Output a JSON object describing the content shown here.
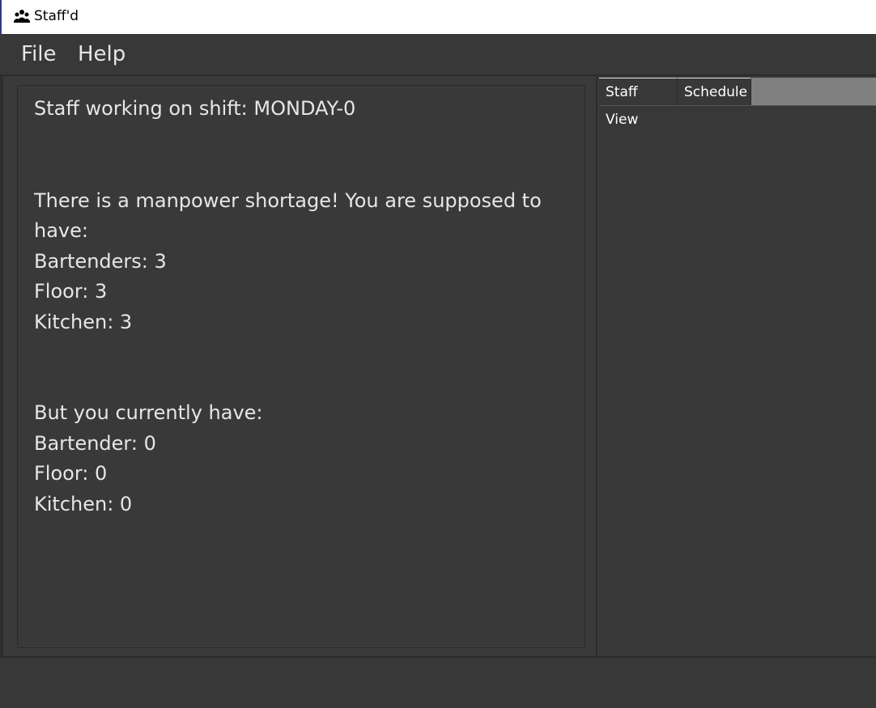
{
  "window": {
    "title": "Staff'd",
    "icon": "people-icon"
  },
  "menu": {
    "items": [
      {
        "label": "File"
      },
      {
        "label": "Help"
      }
    ]
  },
  "result": {
    "lines": [
      "Staff working on shift: MONDAY-0",
      "There is a manpower shortage! You are supposed to",
      "have:",
      "Bartenders: 3",
      "Floor: 3",
      "Kitchen: 3",
      "But you currently have:",
      "Bartender: 0",
      "Floor: 0",
      "Kitchen: 0"
    ]
  },
  "tabs": {
    "items": [
      {
        "label": "Staff View"
      },
      {
        "label": "Schedule"
      }
    ]
  },
  "colors": {
    "background": "#3a3a3a",
    "text": "#e6e6e6",
    "tab_strip": "#808080",
    "titlebar": "#ffffff"
  }
}
